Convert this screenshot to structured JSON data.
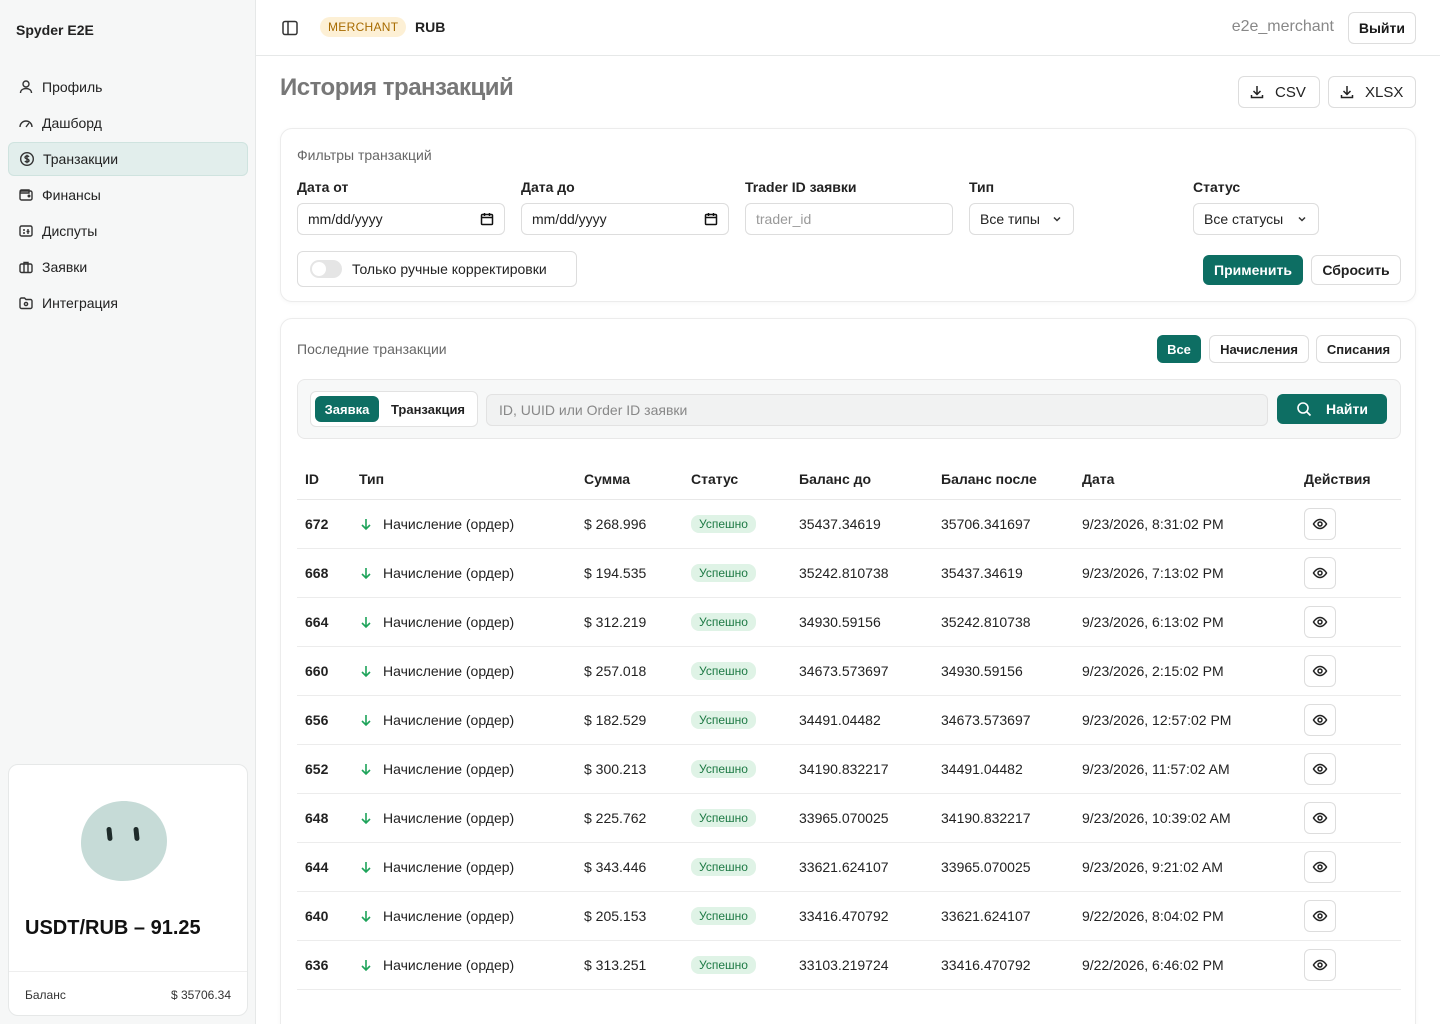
{
  "app": {
    "brand": "Spyder E2E"
  },
  "sidebar": {
    "items": [
      {
        "label": "Профиль",
        "icon": "user-icon"
      },
      {
        "label": "Дашборд",
        "icon": "gauge-icon"
      },
      {
        "label": "Транзакции",
        "icon": "dollar-circle-icon",
        "active": true
      },
      {
        "label": "Финансы",
        "icon": "wallet-icon"
      },
      {
        "label": "Диспуты",
        "icon": "dispute-icon"
      },
      {
        "label": "Заявки",
        "icon": "briefcase-icon"
      },
      {
        "label": "Интеграция",
        "icon": "folder-icon"
      }
    ],
    "card": {
      "rate": "USDT/RUB – 91.25",
      "balance_label": "Баланс",
      "balance_value": "$ 35706.34"
    }
  },
  "topbar": {
    "role_badge": "MERCHANT",
    "currency": "RUB",
    "username": "e2e_merchant",
    "logout_label": "Выйти"
  },
  "page": {
    "title": "История транзакций",
    "export_csv": "CSV",
    "export_xlsx": "XLSX"
  },
  "filters": {
    "title": "Фильтры транзакций",
    "date_from_label": "Дата от",
    "date_from_value": "mm/dd/yyyy",
    "date_to_label": "Дата до",
    "date_to_value": "mm/dd/yyyy",
    "trader_label": "Trader ID заявки",
    "trader_placeholder": "trader_id",
    "type_label": "Тип",
    "type_value": "Все типы",
    "status_label": "Статус",
    "status_value": "Все статусы",
    "manual_toggle_label": "Только ручные корректировки",
    "apply_label": "Применить",
    "reset_label": "Сбросить"
  },
  "recent": {
    "title": "Последние транзакции",
    "tabs": [
      "Все",
      "Начисления",
      "Списания"
    ],
    "mode_tabs": [
      "Заявка",
      "Транзакция"
    ],
    "search_placeholder": "ID, UUID или Order ID заявки",
    "find_label": "Найти",
    "columns": [
      "ID",
      "Тип",
      "Сумма",
      "Статус",
      "Баланс до",
      "Баланс после",
      "Дата",
      "Действия"
    ],
    "rows": [
      {
        "id": "672",
        "type": "Начисление (ордер)",
        "amount": "$ 268.996",
        "status": "Успешно",
        "before": "35437.34619",
        "after": "35706.341697",
        "date": "9/23/2026, 8:31:02 PM"
      },
      {
        "id": "668",
        "type": "Начисление (ордер)",
        "amount": "$ 194.535",
        "status": "Успешно",
        "before": "35242.810738",
        "after": "35437.34619",
        "date": "9/23/2026, 7:13:02 PM"
      },
      {
        "id": "664",
        "type": "Начисление (ордер)",
        "amount": "$ 312.219",
        "status": "Успешно",
        "before": "34930.59156",
        "after": "35242.810738",
        "date": "9/23/2026, 6:13:02 PM"
      },
      {
        "id": "660",
        "type": "Начисление (ордер)",
        "amount": "$ 257.018",
        "status": "Успешно",
        "before": "34673.573697",
        "after": "34930.59156",
        "date": "9/23/2026, 2:15:02 PM"
      },
      {
        "id": "656",
        "type": "Начисление (ордер)",
        "amount": "$ 182.529",
        "status": "Успешно",
        "before": "34491.04482",
        "after": "34673.573697",
        "date": "9/23/2026, 12:57:02 PM"
      },
      {
        "id": "652",
        "type": "Начисление (ордер)",
        "amount": "$ 300.213",
        "status": "Успешно",
        "before": "34190.832217",
        "after": "34491.04482",
        "date": "9/23/2026, 11:57:02 AM"
      },
      {
        "id": "648",
        "type": "Начисление (ордер)",
        "amount": "$ 225.762",
        "status": "Успешно",
        "before": "33965.070025",
        "after": "34190.832217",
        "date": "9/23/2026, 10:39:02 AM"
      },
      {
        "id": "644",
        "type": "Начисление (ордер)",
        "amount": "$ 343.446",
        "status": "Успешно",
        "before": "33621.624107",
        "after": "33965.070025",
        "date": "9/23/2026, 9:21:02 AM"
      },
      {
        "id": "640",
        "type": "Начисление (ордер)",
        "amount": "$ 205.153",
        "status": "Успешно",
        "before": "33416.470792",
        "after": "33621.624107",
        "date": "9/22/2026, 8:04:02 PM"
      },
      {
        "id": "636",
        "type": "Начисление (ордер)",
        "amount": "$ 313.251",
        "status": "Успешно",
        "before": "33103.219724",
        "after": "33416.470792",
        "date": "9/22/2026, 6:46:02 PM"
      }
    ]
  },
  "colors": {
    "accent": "#0d6e63",
    "success_bg": "#dff3e6",
    "success_fg": "#1e7a45",
    "badge_bg": "#fdf0d5",
    "badge_fg": "#a76b00"
  }
}
